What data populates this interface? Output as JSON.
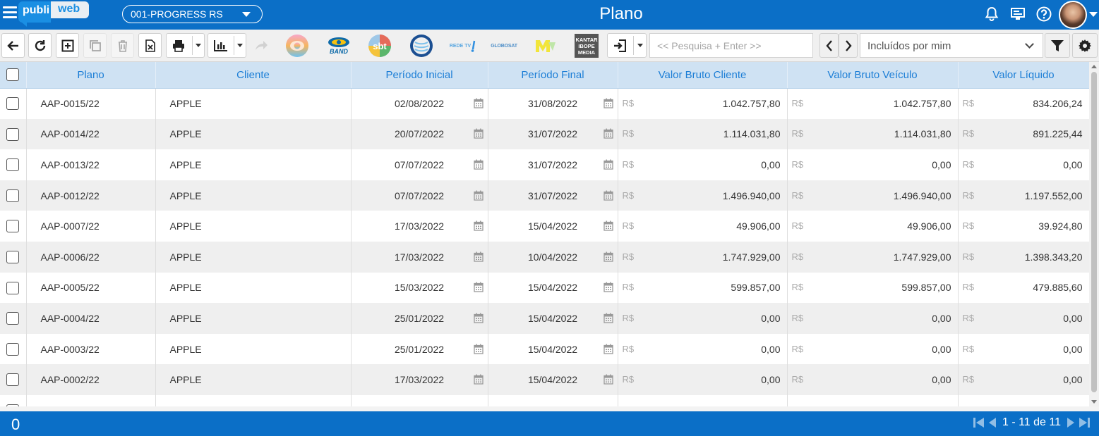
{
  "app": {
    "logo_publi": "publi",
    "logo_web": "web",
    "company": "001-PROGRESS RS",
    "page_title": "Plano"
  },
  "toolbar": {
    "channels": [
      "Globo",
      "BAND",
      "SBT",
      "Record",
      "REDE TV",
      "GLOBOSAT",
      "MTV",
      "KANTAR IBOPE MEDIA"
    ],
    "search_placeholder": "<< Pesquisa + Enter >>",
    "filter_value": "Incluídos por mim"
  },
  "table": {
    "columns": [
      "Plano",
      "Cliente",
      "Período Inicial",
      "Período Final",
      "Valor Bruto Cliente",
      "Valor Bruto Veículo",
      "Valor Líquido"
    ],
    "currency": "R$",
    "rows": [
      {
        "plano": "AAP-0015/22",
        "cliente": "APPLE",
        "inicio": "02/08/2022",
        "fim": "31/08/2022",
        "bruto_cliente": "1.042.757,80",
        "bruto_veiculo": "1.042.757,80",
        "liquido": "834.206,24"
      },
      {
        "plano": "AAP-0014/22",
        "cliente": "APPLE",
        "inicio": "20/07/2022",
        "fim": "31/07/2022",
        "bruto_cliente": "1.114.031,80",
        "bruto_veiculo": "1.114.031,80",
        "liquido": "891.225,44"
      },
      {
        "plano": "AAP-0013/22",
        "cliente": "APPLE",
        "inicio": "07/07/2022",
        "fim": "31/07/2022",
        "bruto_cliente": "0,00",
        "bruto_veiculo": "0,00",
        "liquido": "0,00"
      },
      {
        "plano": "AAP-0012/22",
        "cliente": "APPLE",
        "inicio": "07/07/2022",
        "fim": "31/07/2022",
        "bruto_cliente": "1.496.940,00",
        "bruto_veiculo": "1.496.940,00",
        "liquido": "1.197.552,00"
      },
      {
        "plano": "AAP-0007/22",
        "cliente": "APPLE",
        "inicio": "17/03/2022",
        "fim": "15/04/2022",
        "bruto_cliente": "49.906,00",
        "bruto_veiculo": "49.906,00",
        "liquido": "39.924,80"
      },
      {
        "plano": "AAP-0006/22",
        "cliente": "APPLE",
        "inicio": "17/03/2022",
        "fim": "10/04/2022",
        "bruto_cliente": "1.747.929,00",
        "bruto_veiculo": "1.747.929,00",
        "liquido": "1.398.343,20"
      },
      {
        "plano": "AAP-0005/22",
        "cliente": "APPLE",
        "inicio": "15/03/2022",
        "fim": "15/04/2022",
        "bruto_cliente": "599.857,00",
        "bruto_veiculo": "599.857,00",
        "liquido": "479.885,60"
      },
      {
        "plano": "AAP-0004/22",
        "cliente": "APPLE",
        "inicio": "25/01/2022",
        "fim": "15/04/2022",
        "bruto_cliente": "0,00",
        "bruto_veiculo": "0,00",
        "liquido": "0,00"
      },
      {
        "plano": "AAP-0003/22",
        "cliente": "APPLE",
        "inicio": "25/01/2022",
        "fim": "15/04/2022",
        "bruto_cliente": "0,00",
        "bruto_veiculo": "0,00",
        "liquido": "0,00"
      },
      {
        "plano": "AAP-0002/22",
        "cliente": "APPLE",
        "inicio": "17/03/2022",
        "fim": "15/04/2022",
        "bruto_cliente": "0,00",
        "bruto_veiculo": "0,00",
        "liquido": "0,00"
      }
    ]
  },
  "footer": {
    "selected_count": "0",
    "page_label": "1 - 11 de 11"
  }
}
